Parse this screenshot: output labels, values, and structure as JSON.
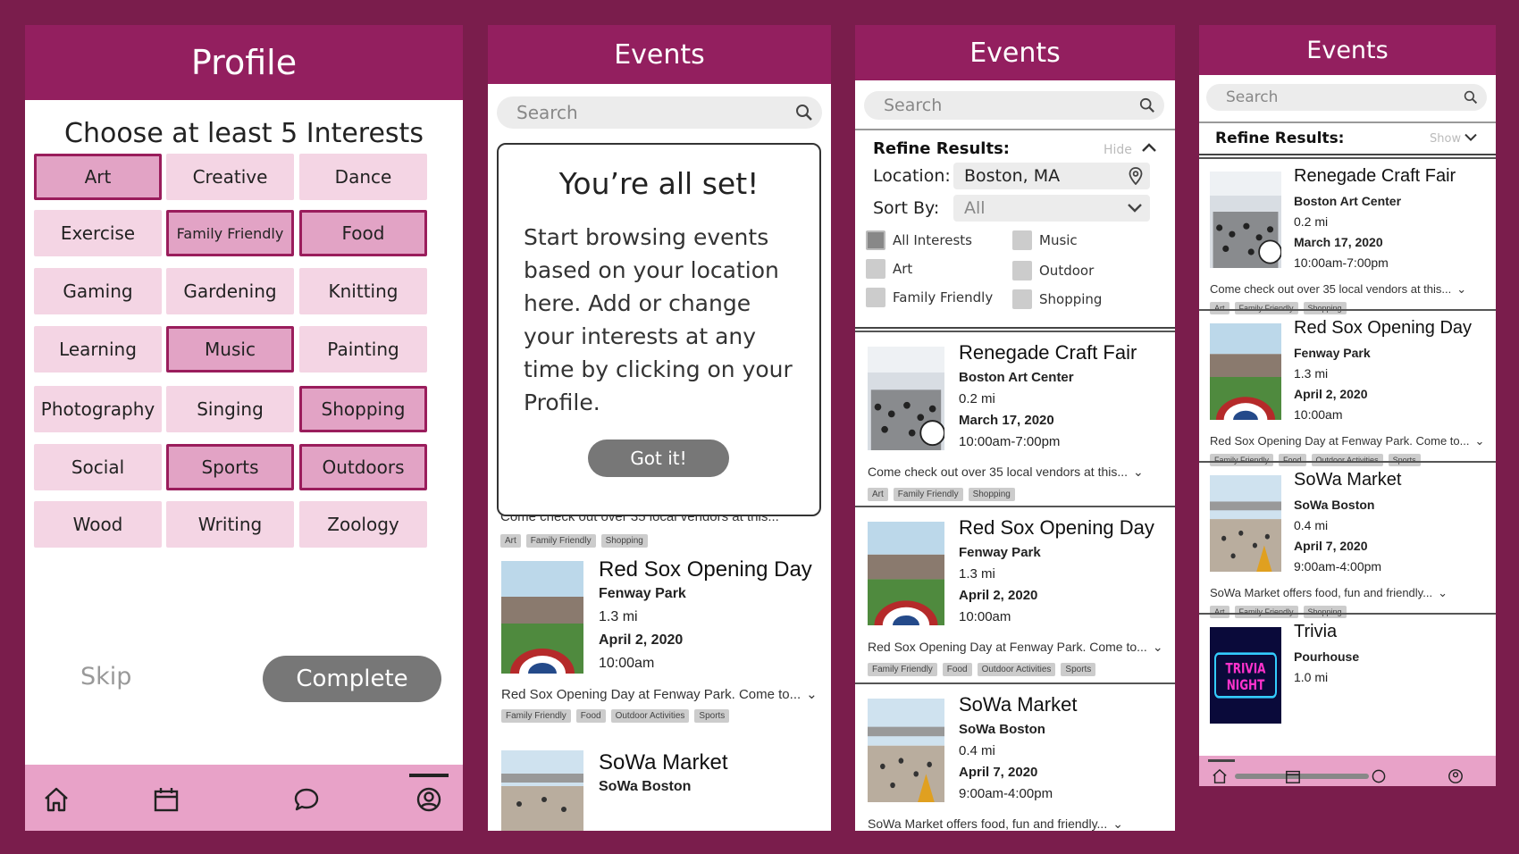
{
  "profile": {
    "title": "Profile",
    "heading": "Choose at least 5 Interests",
    "interests": [
      {
        "label": "Art",
        "selected": true
      },
      {
        "label": "Creative",
        "selected": false
      },
      {
        "label": "Dance",
        "selected": false
      },
      {
        "label": "Exercise",
        "selected": false
      },
      {
        "label": "Family Friendly",
        "selected": true
      },
      {
        "label": "Food",
        "selected": true
      },
      {
        "label": "Gaming",
        "selected": false
      },
      {
        "label": "Gardening",
        "selected": false
      },
      {
        "label": "Knitting",
        "selected": false
      },
      {
        "label": "Learning",
        "selected": false
      },
      {
        "label": "Music",
        "selected": true
      },
      {
        "label": "Painting",
        "selected": false
      },
      {
        "label": "Photography",
        "selected": false
      },
      {
        "label": "Singing",
        "selected": false
      },
      {
        "label": "Shopping",
        "selected": true
      },
      {
        "label": "Social",
        "selected": false
      },
      {
        "label": "Sports",
        "selected": true
      },
      {
        "label": "Outdoors",
        "selected": true
      },
      {
        "label": "Wood",
        "selected": false
      },
      {
        "label": "Writing",
        "selected": false
      },
      {
        "label": "Zoology",
        "selected": false
      }
    ],
    "skip_label": "Skip",
    "complete_label": "Complete"
  },
  "nav": {
    "icons": [
      "home-icon",
      "calendar-icon",
      "chat-icon",
      "profile-icon"
    ],
    "active": "profile-icon"
  },
  "events_title": "Events",
  "search_placeholder": "Search",
  "modal": {
    "title": "You’re all set!",
    "body": "Start browsing events based on your location here. Add or change your interests at any time by clicking on your Profile.",
    "button": "Got it!"
  },
  "refine": {
    "title": "Refine Results:",
    "hide_label": "Hide",
    "show_label": "Show",
    "location_label": "Location:",
    "location_value": "Boston, MA",
    "sort_label": "Sort By:",
    "sort_value": "All",
    "filters": [
      {
        "label": "All Interests",
        "checked": true
      },
      {
        "label": "Music",
        "checked": false
      },
      {
        "label": "Art",
        "checked": false
      },
      {
        "label": "Outdoor",
        "checked": false
      },
      {
        "label": "Family Friendly",
        "checked": false
      },
      {
        "label": "Shopping",
        "checked": false
      }
    ]
  },
  "events": [
    {
      "name": "Renegade Craft Fair",
      "venue": "Boston Art Center",
      "distance": "0.2 mi",
      "date": "March 17, 2020",
      "time": "10:00am-7:00pm",
      "description": "Come check out over 35 local vendors at this...",
      "tags": [
        "Art",
        "Family Friendly",
        "Shopping"
      ]
    },
    {
      "name": "Red Sox Opening Day",
      "venue": "Fenway Park",
      "distance": "1.3 mi",
      "date": "April 2, 2020",
      "time": "10:00am",
      "description": "Red Sox Opening Day at Fenway Park. Come to...",
      "tags": [
        "Family Friendly",
        "Food",
        "Outdoor Activities",
        "Sports"
      ]
    },
    {
      "name": "SoWa Market",
      "venue": "SoWa Boston",
      "distance": "0.4 mi",
      "date": "April 7, 2020",
      "time": "9:00am-4:00pm",
      "description": "SoWa Market offers food, fun and friendly...",
      "tags": [
        "Art",
        "Family Friendly",
        "Shopping"
      ]
    },
    {
      "name": "Trivia",
      "venue": "Pourhouse",
      "distance": "1.0 mi",
      "thumb_text": "TRIVIA NIGHT"
    }
  ],
  "colors": {
    "brand": "#931f5f",
    "background": "#7a1d4c",
    "chip": "#f4d5e4",
    "chip_selected": "#e2a3c5",
    "nav": "#e8a2c8"
  }
}
